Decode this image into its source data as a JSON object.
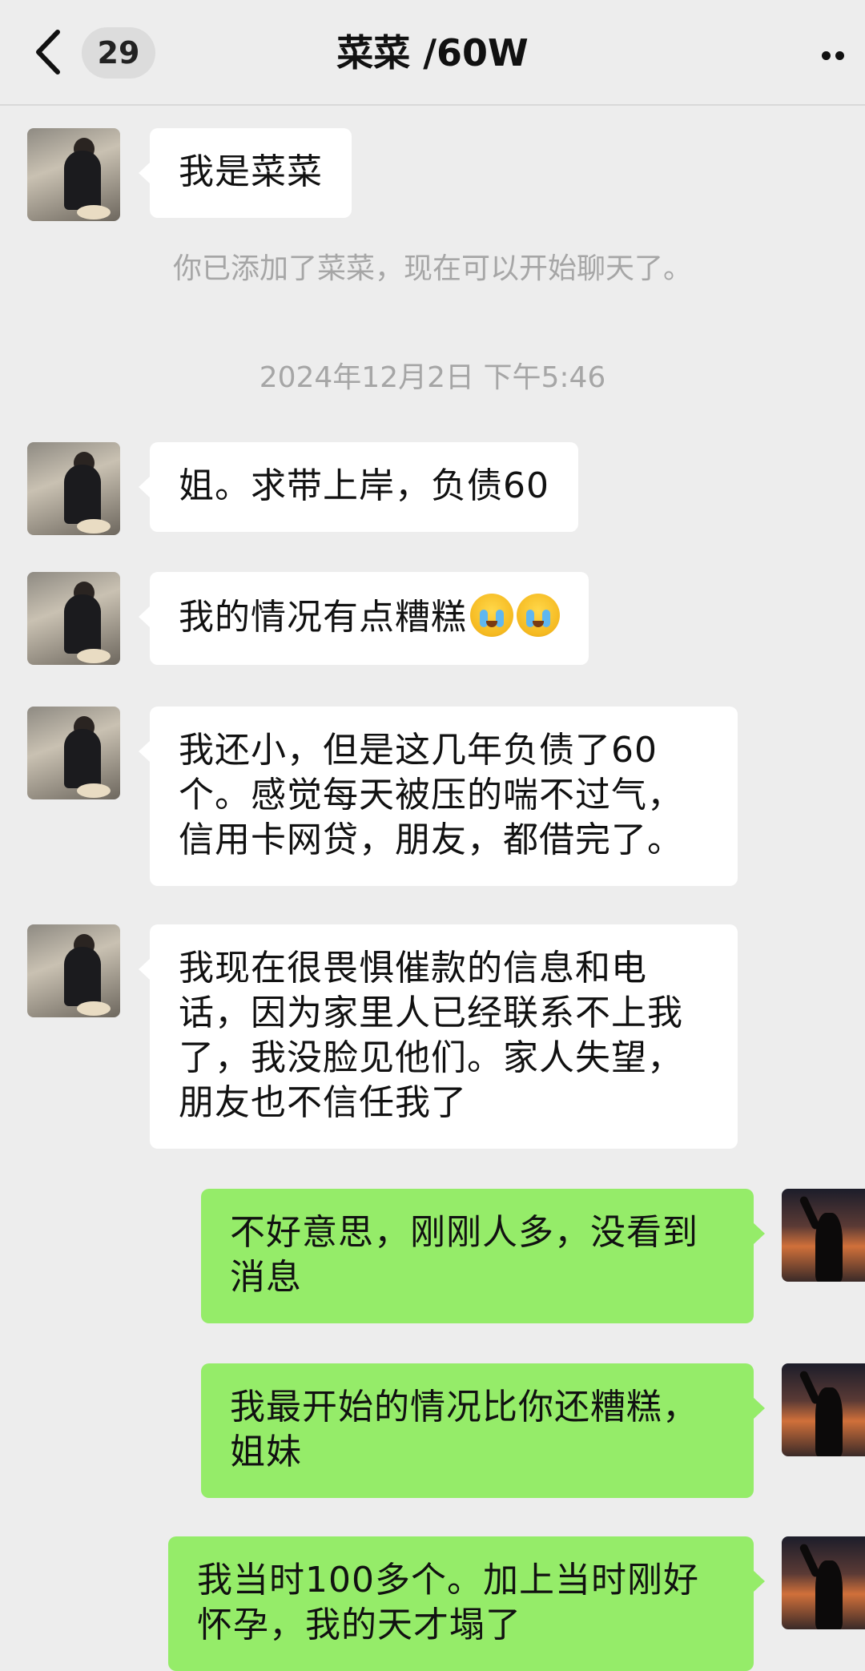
{
  "header": {
    "unread_count": "29",
    "title": "菜菜 /60W"
  },
  "messages": [
    {
      "side": "in",
      "text": "我是菜菜"
    },
    {
      "side": "in",
      "text": "姐。求带上岸，负债60"
    },
    {
      "side": "in",
      "text": "我的情况有点糟糕",
      "emoji": [
        "cry-icon",
        "cry-icon"
      ]
    },
    {
      "side": "in",
      "text": "我还小，但是这几年负债了60个。感觉每天被压的喘不过气，信用卡网贷，朋友，都借完了。"
    },
    {
      "side": "in",
      "text": "我现在很畏惧催款的信息和电话，因为家里人已经联系不上我了，我没脸见他们。家人失望，朋友也不信任我了"
    },
    {
      "side": "out",
      "text": "不好意思，刚刚人多，没看到消息"
    },
    {
      "side": "out",
      "text": "我最开始的情况比你还糟糕，姐妹"
    },
    {
      "side": "out",
      "text": "我当时100多个。加上当时刚好怀孕，我的天才塌了"
    }
  ],
  "system": {
    "added_notice": "你已添加了菜菜，现在可以开始聊天了。",
    "timestamp": "2024年12月2日 下午5:46"
  },
  "colors": {
    "background": "#ededed",
    "incoming_bubble": "#ffffff",
    "outgoing_bubble": "#95ec69"
  }
}
